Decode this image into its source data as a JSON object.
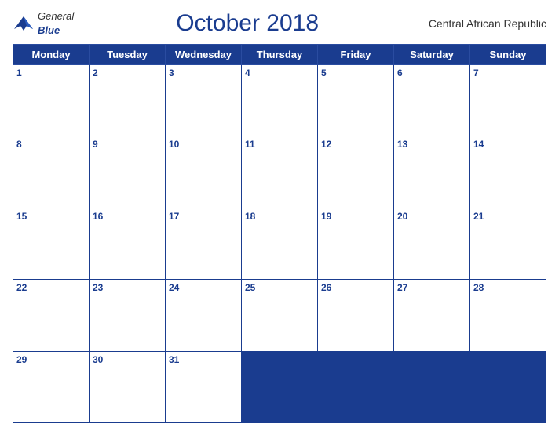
{
  "header": {
    "logo": {
      "general": "General",
      "blue": "Blue",
      "bird_symbol": "▲"
    },
    "title": "October 2018",
    "country": "Central African Republic"
  },
  "calendar": {
    "weekdays": [
      "Monday",
      "Tuesday",
      "Wednesday",
      "Thursday",
      "Friday",
      "Saturday",
      "Sunday"
    ],
    "weeks": [
      [
        1,
        2,
        3,
        4,
        5,
        6,
        7
      ],
      [
        8,
        9,
        10,
        11,
        12,
        13,
        14
      ],
      [
        15,
        16,
        17,
        18,
        19,
        20,
        21
      ],
      [
        22,
        23,
        24,
        25,
        26,
        27,
        28
      ],
      [
        29,
        30,
        31,
        null,
        null,
        null,
        null
      ]
    ]
  }
}
